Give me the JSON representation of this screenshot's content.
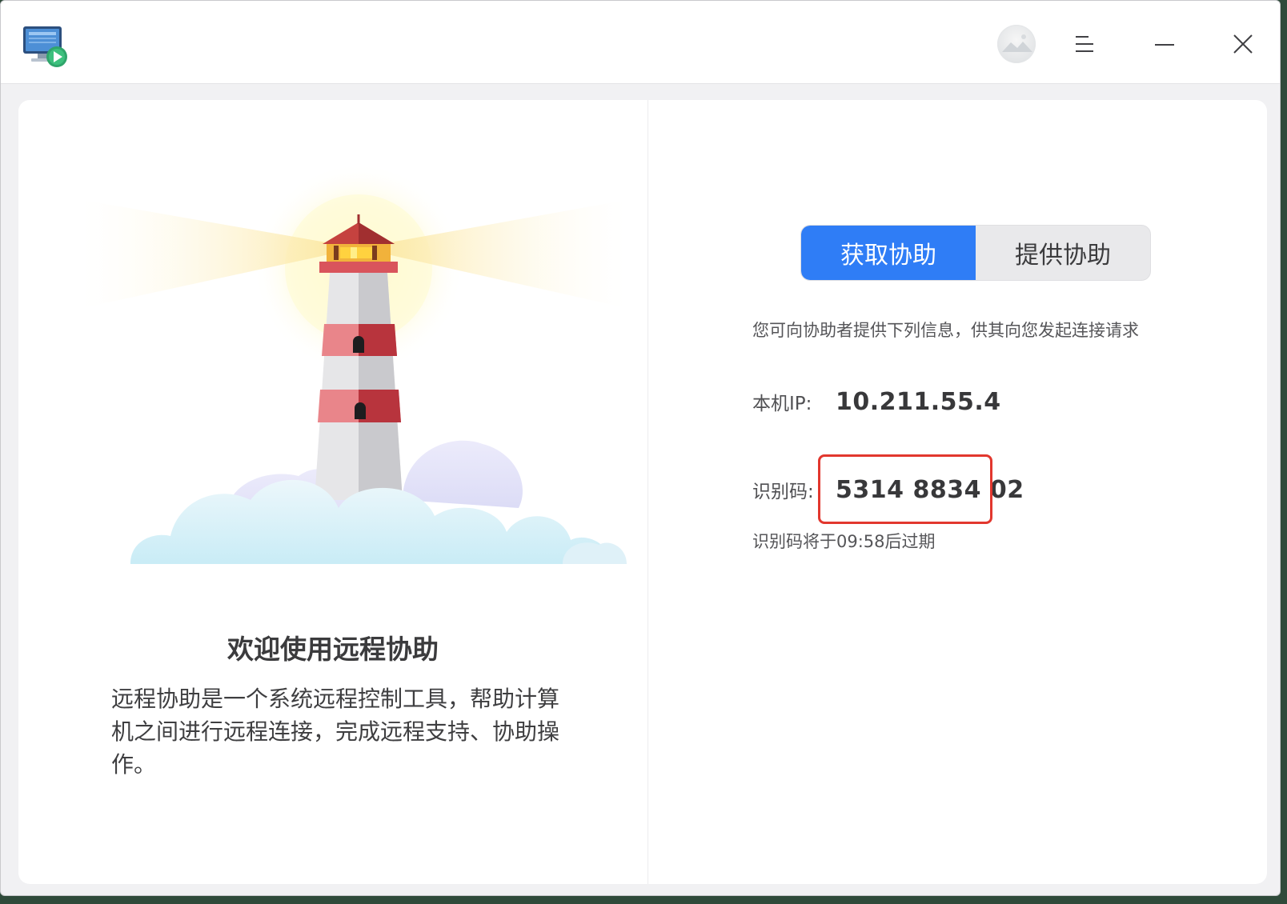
{
  "titlebar": {
    "app_icon": "remote-assistance-app-icon",
    "avatar": "user-avatar",
    "menu_icon": "menu-icon",
    "minimize_icon": "minimize-icon",
    "close_icon": "close-icon"
  },
  "left": {
    "illustration": "lighthouse-illustration",
    "title": "欢迎使用远程协助",
    "description": "远程协助是一个系统远程控制工具，帮助计算机之间进行远程连接，完成远程支持、协助操作。"
  },
  "right": {
    "tabs": [
      {
        "label": "获取协助",
        "active": true
      },
      {
        "label": "提供协助",
        "active": false
      }
    ],
    "hint": "您可向协助者提供下列信息，供其向您发起连接请求",
    "ip_label": "本机IP:",
    "ip_value": "10.211.55.4",
    "code_label": "识别码:",
    "code_value": "5314 8834 02",
    "expire_text": "识别码将于09:58后过期"
  },
  "colors": {
    "accent": "#2f7df6",
    "highlight_box": "#e2372e"
  }
}
